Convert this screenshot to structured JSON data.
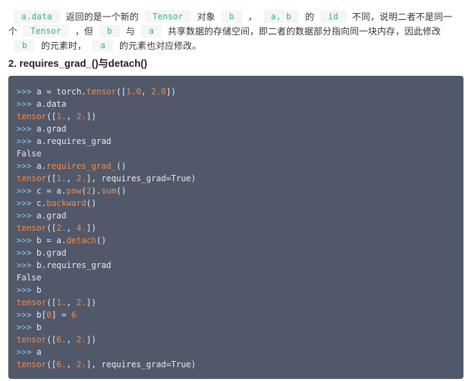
{
  "paragraph": {
    "chip1": "a.data",
    "t1": "返回的是一个新的",
    "chip2": "Tensor",
    "t2": "对象",
    "chip3": "b",
    "t3": "，",
    "chip4": "a, b",
    "t4": "的",
    "chip5": "id",
    "t5": "不同，说明二者不是同一个",
    "chip6": "Tensor",
    "t6": "，但",
    "chip7": "b",
    "t7": "与",
    "chip8": "a",
    "t8": "共享数据的存储空间，即二者的数据部分指向同一块内存，因此修改",
    "chip9": "b",
    "t9": "的元素时，",
    "chip10": "a",
    "t10": "的元素也对应修改。"
  },
  "heading": "2. requires_grad_()与detach()",
  "code_lines": [
    [
      [
        "p",
        ">>> "
      ],
      [
        "o",
        "a = torch."
      ],
      [
        "f",
        "tensor"
      ],
      [
        "o",
        "(["
      ],
      [
        "f",
        "1.0"
      ],
      [
        "o",
        ", "
      ],
      [
        "f",
        "2.0"
      ],
      [
        "o",
        "])"
      ]
    ],
    [
      [
        "p",
        ">>> "
      ],
      [
        "o",
        "a.data"
      ]
    ],
    [
      [
        "f",
        "tensor"
      ],
      [
        "o",
        "(["
      ],
      [
        "f",
        "1."
      ],
      [
        "o",
        ", "
      ],
      [
        "f",
        "2."
      ],
      [
        "o",
        "])"
      ]
    ],
    [
      [
        "p",
        ">>> "
      ],
      [
        "o",
        "a.grad"
      ]
    ],
    [
      [
        "p",
        ">>> "
      ],
      [
        "o",
        "a.requires_grad"
      ]
    ],
    [
      [
        "o",
        "False"
      ]
    ],
    [
      [
        "p",
        ">>> "
      ],
      [
        "o",
        "a."
      ],
      [
        "f",
        "requires_grad_"
      ],
      [
        "o",
        "()"
      ]
    ],
    [
      [
        "f",
        "tensor"
      ],
      [
        "o",
        "(["
      ],
      [
        "f",
        "1."
      ],
      [
        "o",
        ", "
      ],
      [
        "f",
        "2."
      ],
      [
        "o",
        "], requires_grad=True)"
      ]
    ],
    [
      [
        "p",
        ">>> "
      ],
      [
        "o",
        "c = a."
      ],
      [
        "f",
        "pow"
      ],
      [
        "o",
        "("
      ],
      [
        "f",
        "2"
      ],
      [
        "o",
        ")."
      ],
      [
        "f",
        "sum"
      ],
      [
        "o",
        "()"
      ]
    ],
    [
      [
        "p",
        ">>> "
      ],
      [
        "o",
        "c."
      ],
      [
        "f",
        "backward"
      ],
      [
        "o",
        "()"
      ]
    ],
    [
      [
        "p",
        ">>> "
      ],
      [
        "o",
        "a.grad"
      ]
    ],
    [
      [
        "f",
        "tensor"
      ],
      [
        "o",
        "(["
      ],
      [
        "f",
        "2."
      ],
      [
        "o",
        ", "
      ],
      [
        "f",
        "4."
      ],
      [
        "o",
        "])"
      ]
    ],
    [
      [
        "p",
        ">>> "
      ],
      [
        "o",
        "b = a."
      ],
      [
        "f",
        "detach"
      ],
      [
        "o",
        "()"
      ]
    ],
    [
      [
        "p",
        ">>> "
      ],
      [
        "o",
        "b.grad"
      ]
    ],
    [
      [
        "p",
        ">>> "
      ],
      [
        "o",
        "b.requires_grad"
      ]
    ],
    [
      [
        "o",
        "False"
      ]
    ],
    [
      [
        "p",
        ">>> "
      ],
      [
        "o",
        "b"
      ]
    ],
    [
      [
        "f",
        "tensor"
      ],
      [
        "o",
        "(["
      ],
      [
        "f",
        "1."
      ],
      [
        "o",
        ", "
      ],
      [
        "f",
        "2."
      ],
      [
        "o",
        "])"
      ]
    ],
    [
      [
        "p",
        ">>> "
      ],
      [
        "o",
        "b["
      ],
      [
        "f",
        "0"
      ],
      [
        "o",
        "] = "
      ],
      [
        "f",
        "6"
      ]
    ],
    [
      [
        "p",
        ">>> "
      ],
      [
        "o",
        "b"
      ]
    ],
    [
      [
        "f",
        "tensor"
      ],
      [
        "o",
        "(["
      ],
      [
        "f",
        "6."
      ],
      [
        "o",
        ", "
      ],
      [
        "f",
        "2."
      ],
      [
        "o",
        "])"
      ]
    ],
    [
      [
        "p",
        ">>> "
      ],
      [
        "o",
        "a"
      ]
    ],
    [
      [
        "f",
        "tensor"
      ],
      [
        "o",
        "(["
      ],
      [
        "f",
        "6."
      ],
      [
        "o",
        ", "
      ],
      [
        "f",
        "2."
      ],
      [
        "o",
        "], requires_grad=True)"
      ]
    ]
  ],
  "colors": {
    "code_background": "#50586a",
    "inline_code_text": "#3eaf7c",
    "inline_code_background": "#f3f5f7",
    "prompt": "#8ec8ec",
    "highlight": "#f08d49"
  }
}
